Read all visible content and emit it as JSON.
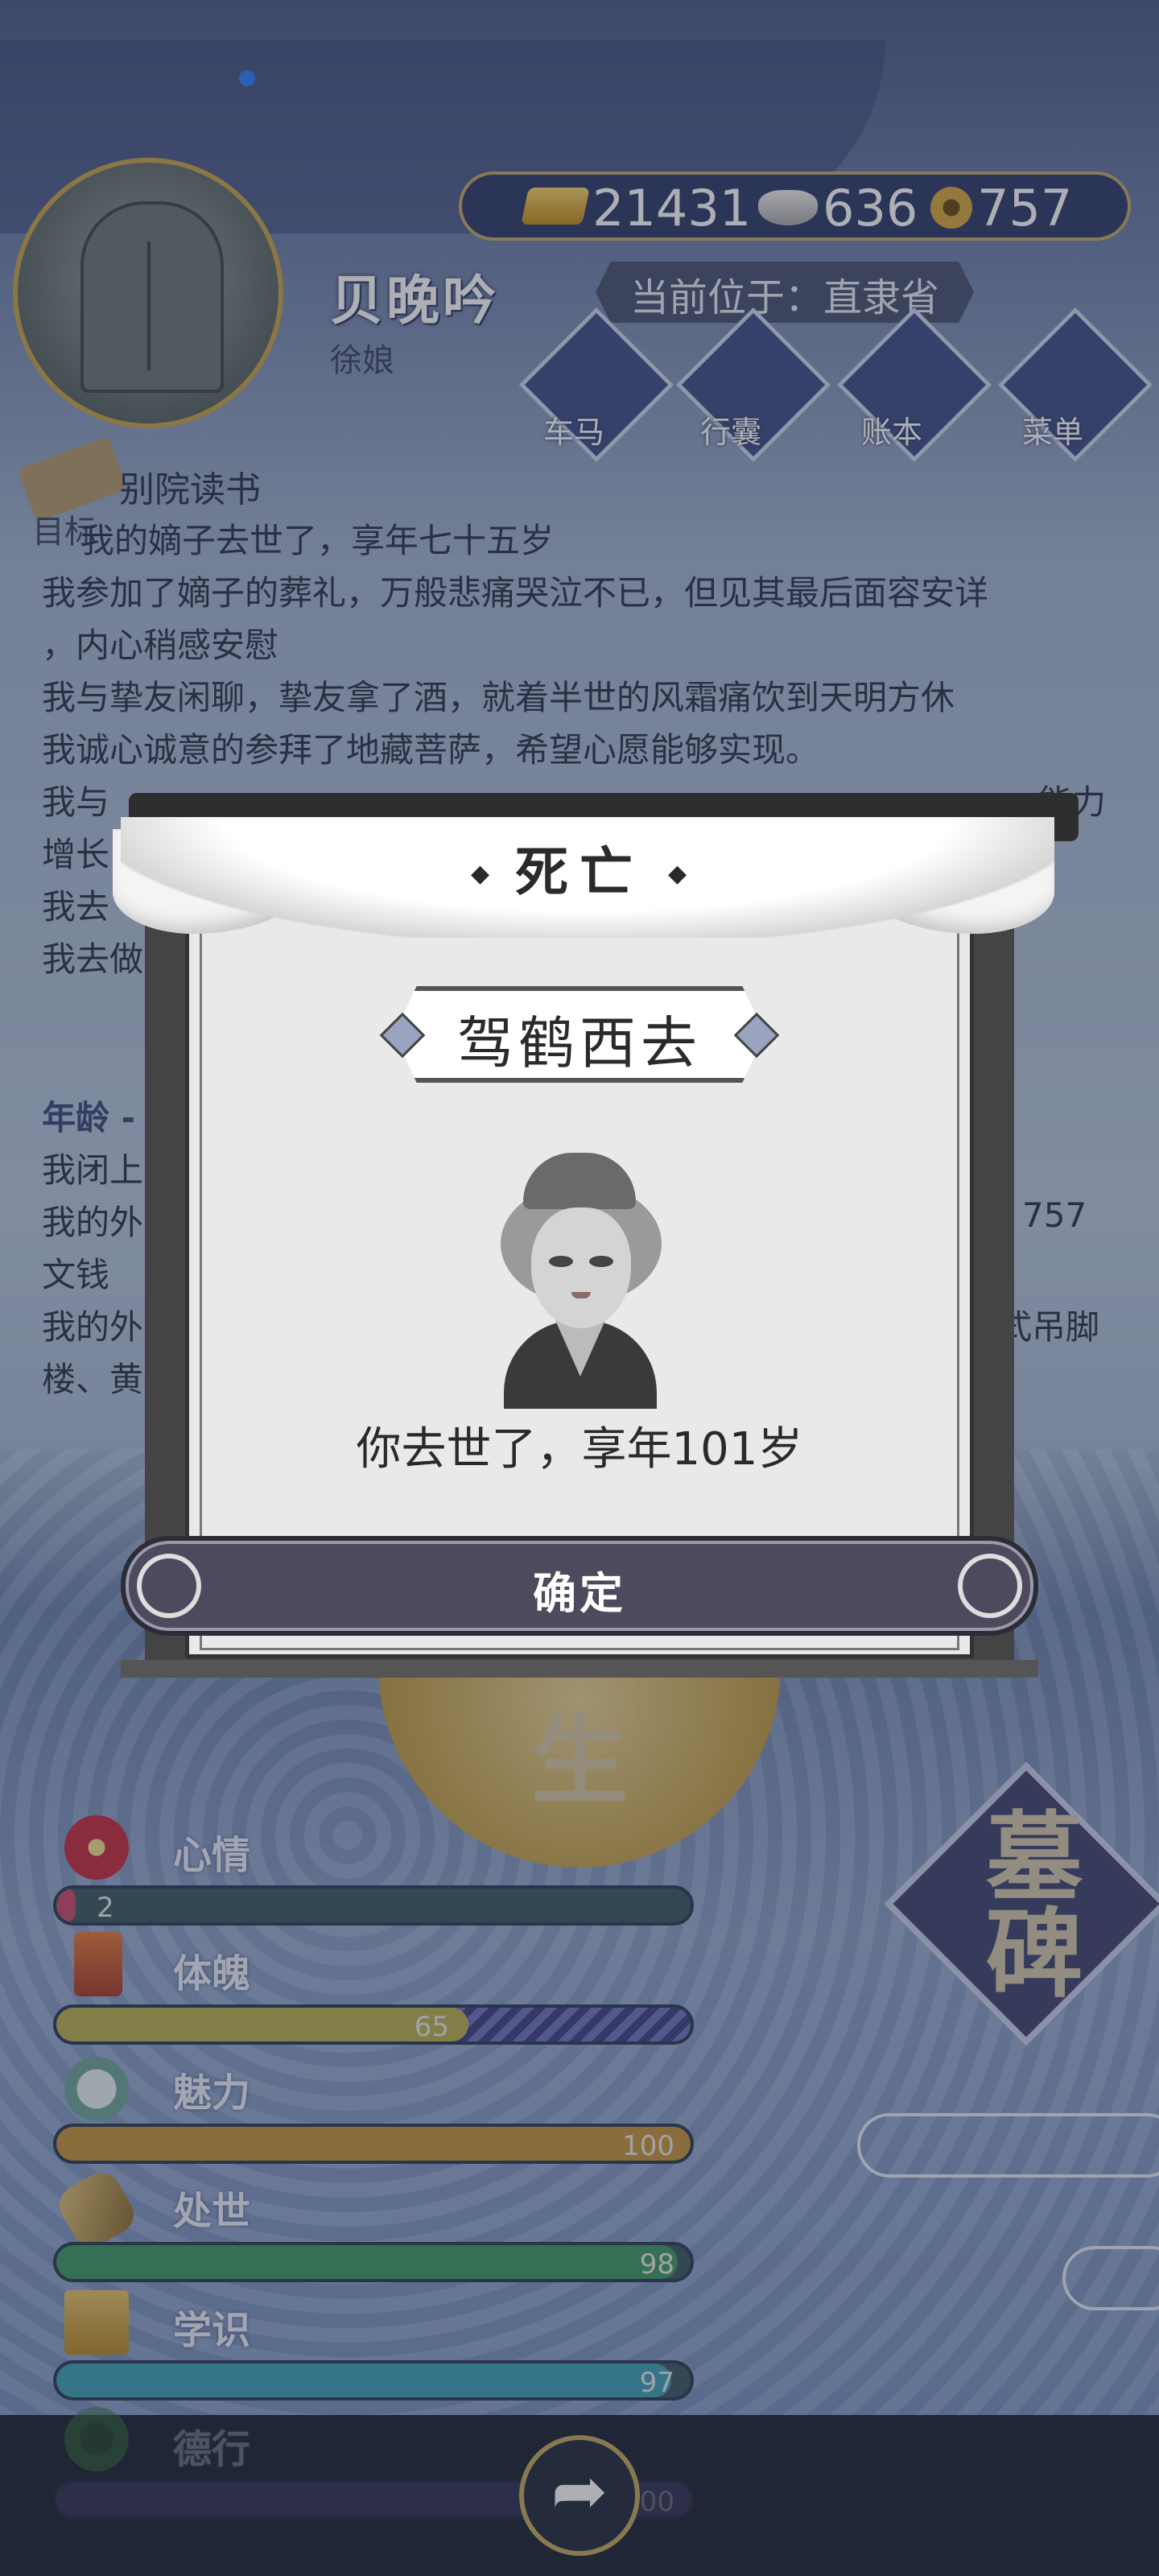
{
  "header": {
    "player_name": "贝晚吟",
    "player_title": "徐娘",
    "location": "当前位于：直隶省",
    "currency": {
      "gold": "21431",
      "silver": "636",
      "copper": "757"
    }
  },
  "menu": {
    "carriage": "车马",
    "luggage": "行囊",
    "ledger": "账本",
    "menu": "菜单"
  },
  "goal": {
    "label": "目标",
    "text": "别院读书"
  },
  "log": {
    "lines": [
      "我的嫡子去世了，享年七十五岁",
      "我参加了嫡子的葬礼，万般悲痛哭泣不已，但见其最后面容安详",
      "，内心稍感安慰",
      "我与挚友闲聊，挚友拿了酒，就着半世的风霜痛饮到天明方休",
      "我诚心诚意的参拜了地藏菩萨，希望心愿能够实现。",
      "我与",
      "增长",
      "我去",
      "我去做"
    ],
    "age_head": "年龄 -",
    "lines2": [
      "我闭上",
      "我的外",
      "文钱",
      "我的外",
      "楼、黄"
    ],
    "tail1_a": "能力",
    "tail2": "757",
    "tail3": "式吊脚"
  },
  "modal": {
    "title": "死亡",
    "death_type": "驾鹤西去",
    "death_text": "你去世了，享年101岁",
    "confirm_label": "确定"
  },
  "life_badge": "生",
  "tombstone": {
    "line1": "墓",
    "line2": "碑"
  },
  "stats": [
    {
      "label": "心情",
      "value": "2",
      "fraction": 0.02,
      "color": "#c94b6e"
    },
    {
      "label": "体魄",
      "value": "65",
      "fraction": 0.65,
      "color": "#b8b24e"
    },
    {
      "label": "魅力",
      "value": "100",
      "fraction": 1.0,
      "color": "#c9953a"
    },
    {
      "label": "处世",
      "value": "98",
      "fraction": 0.98,
      "color": "#3e9a64"
    },
    {
      "label": "学识",
      "value": "97",
      "fraction": 0.97,
      "color": "#3fa0b6"
    },
    {
      "label": "德行",
      "value": "100",
      "fraction": 1.0,
      "color": "#5a4a8a"
    }
  ]
}
